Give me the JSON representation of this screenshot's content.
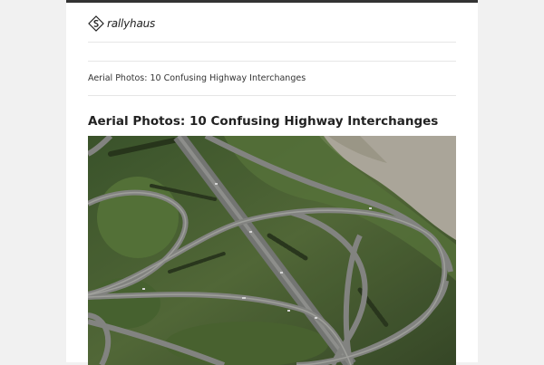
{
  "site": {
    "brand_name": "rallyhaus",
    "logo_icon": "diamond-s-logo-icon"
  },
  "breadcrumb": {
    "current": "Aerial Photos: 10 Confusing Highway Interchanges"
  },
  "article": {
    "title": "Aerial Photos: 10 Confusing Highway Interchanges",
    "image_alt": "Aerial photo of highway interchanges"
  },
  "colors": {
    "top_bar": "#333333",
    "background": "#f1f1f1",
    "content": "#ffffff",
    "text": "#222222"
  }
}
